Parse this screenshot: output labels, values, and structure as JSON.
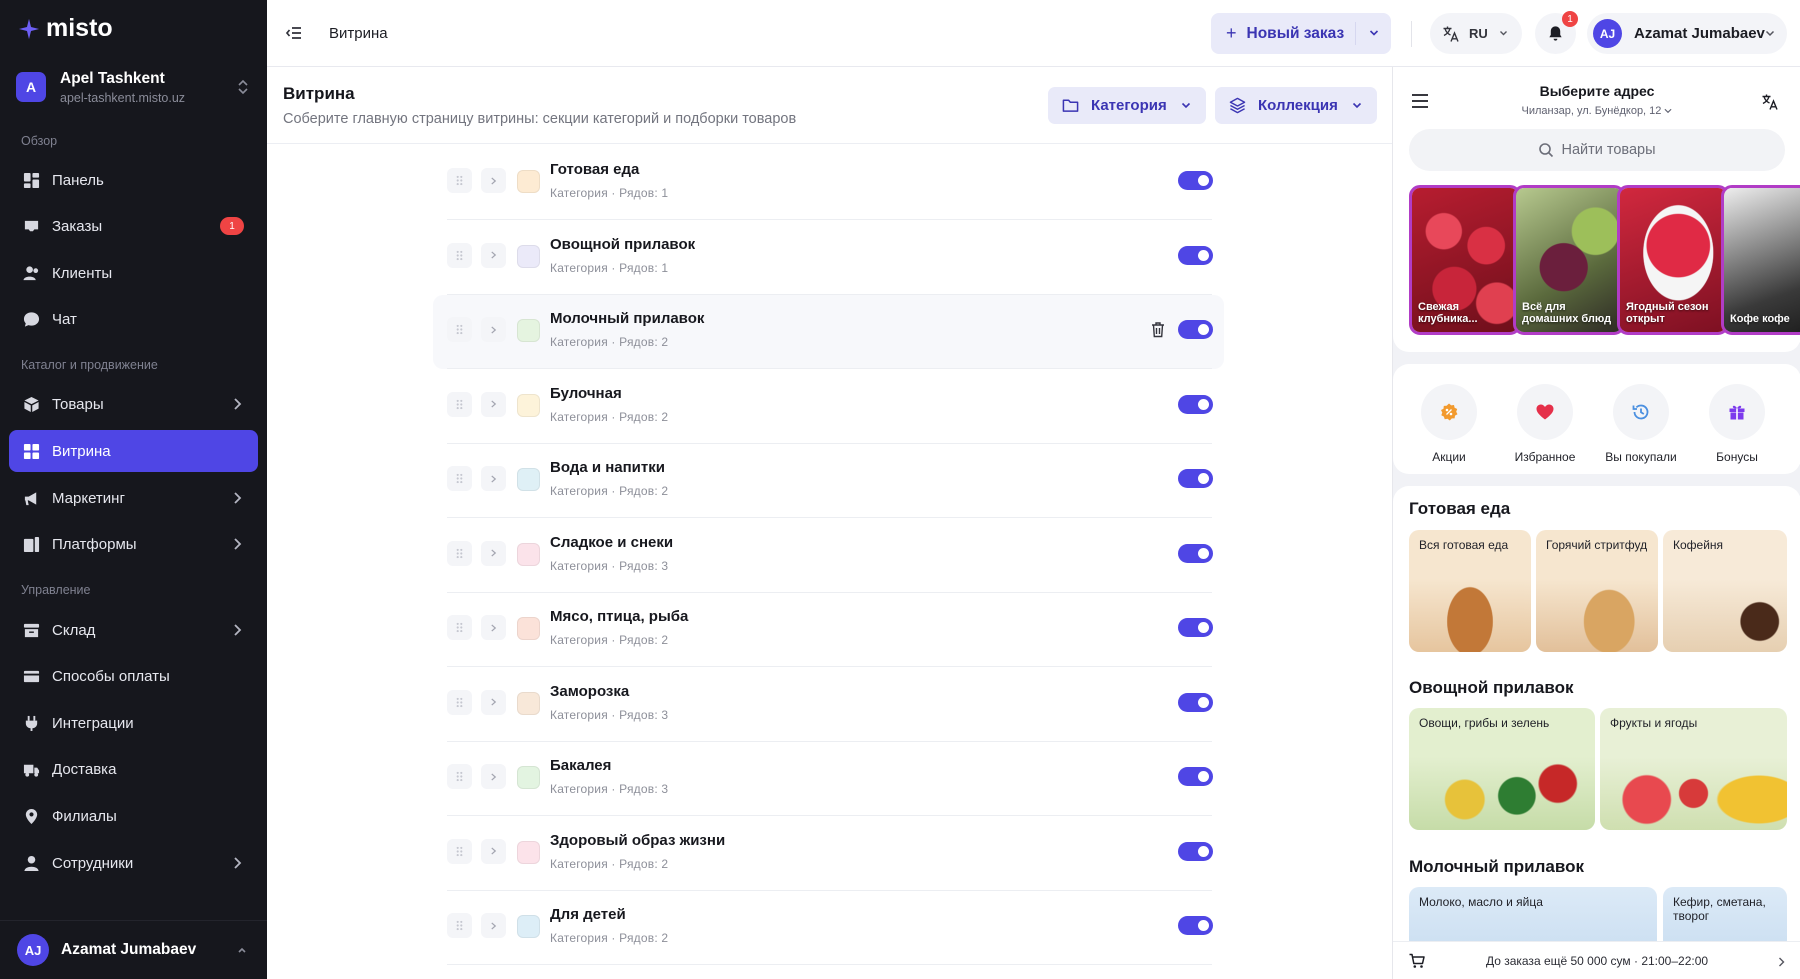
{
  "brand": {
    "name": "misto"
  },
  "org": {
    "initial": "A",
    "name": "Apel Tashkent",
    "url": "apel-tashkent.misto.uz"
  },
  "sidebar": {
    "sections": {
      "overview": "Обзор",
      "catalog": "Каталог и продвижение",
      "management": "Управление"
    },
    "items": [
      {
        "label": "Панель",
        "icon": "dashboard-icon"
      },
      {
        "label": "Заказы",
        "icon": "orders-icon",
        "badge": "1"
      },
      {
        "label": "Клиенты",
        "icon": "users-icon"
      },
      {
        "label": "Чат",
        "icon": "chat-icon"
      },
      {
        "label": "Товары",
        "icon": "box-icon"
      },
      {
        "label": "Витрина",
        "icon": "grid-icon",
        "active": true
      },
      {
        "label": "Маркетинг",
        "icon": "megaphone-icon"
      },
      {
        "label": "Платформы",
        "icon": "platforms-icon"
      },
      {
        "label": "Склад",
        "icon": "warehouse-icon"
      },
      {
        "label": "Способы оплаты",
        "icon": "card-icon"
      },
      {
        "label": "Интеграции",
        "icon": "plug-icon"
      },
      {
        "label": "Доставка",
        "icon": "truck-icon"
      },
      {
        "label": "Филиалы",
        "icon": "pin-icon"
      },
      {
        "label": "Сотрудники",
        "icon": "staff-icon"
      }
    ],
    "user": {
      "initials": "AJ",
      "name": "Azamat Jumabaev"
    }
  },
  "topbar": {
    "breadcrumb": "Витрина",
    "new_order": "Новый заказ",
    "lang": "RU",
    "notifications": "1",
    "user": {
      "initials": "AJ",
      "name": "Azamat Jumabaev"
    }
  },
  "page": {
    "title": "Витрина",
    "subtitle": "Соберите главную страницу витрины: секции категорий и подборки товаров",
    "btn_category": "Категория",
    "btn_collection": "Коллекция"
  },
  "sections": [
    {
      "name": "Готовая еда",
      "meta": "Категория · Рядов: 1",
      "color": "#fdebd3",
      "enabled": true
    },
    {
      "name": "Овощной прилавок",
      "meta": "Категория · Рядов: 1",
      "color": "#ebeaf9",
      "enabled": true
    },
    {
      "name": "Молочный прилавок",
      "meta": "Категория · Рядов: 2",
      "color": "#e5f4e0",
      "enabled": true,
      "hovered": true
    },
    {
      "name": "Булочная",
      "meta": "Категория · Рядов: 2",
      "color": "#fdf3da",
      "enabled": true
    },
    {
      "name": "Вода и напитки",
      "meta": "Категория · Рядов: 2",
      "color": "#dff0f6",
      "enabled": true
    },
    {
      "name": "Сладкое и снеки",
      "meta": "Категория · Рядов: 3",
      "color": "#fbe3ea",
      "enabled": true
    },
    {
      "name": "Мясо, птица, рыба",
      "meta": "Категория · Рядов: 2",
      "color": "#fbe2d9",
      "enabled": true
    },
    {
      "name": "Заморозка",
      "meta": "Категория · Рядов: 3",
      "color": "#f8e8d9",
      "enabled": true
    },
    {
      "name": "Бакалея",
      "meta": "Категория · Рядов: 3",
      "color": "#e3f4e1",
      "enabled": true
    },
    {
      "name": "Здоровый образ жизни",
      "meta": "Категория · Рядов: 2",
      "color": "#fce3ea",
      "enabled": true
    },
    {
      "name": "Для детей",
      "meta": "Категория · Рядов: 2",
      "color": "#ddeef7",
      "enabled": true
    }
  ],
  "preview": {
    "address_title": "Выберите адрес",
    "address_sub": "Чиланзар, ул. Бунёдкор, 12",
    "search_placeholder": "Найти товары",
    "stories": [
      {
        "caption": "Свежая клубника..."
      },
      {
        "caption": "Всё для домашних блюд"
      },
      {
        "caption": "Ягодный сезон открыт"
      },
      {
        "caption": "Кофе кофе"
      }
    ],
    "quick": [
      {
        "label": "Акции",
        "icon": "percent-icon"
      },
      {
        "label": "Избранное",
        "icon": "heart-icon"
      },
      {
        "label": "Вы покупали",
        "icon": "history-icon"
      },
      {
        "label": "Бонусы",
        "icon": "gift-icon"
      }
    ],
    "shop_sections": [
      {
        "title": "Готовая еда",
        "tiles": [
          "Вся готовая еда",
          "Горячий стритфуд",
          "Кофейня"
        ]
      },
      {
        "title": "Овощной прилавок",
        "tiles": [
          "Овощи, грибы и зелень",
          "Фрукты и ягоды"
        ]
      },
      {
        "title": "Молочный прилавок",
        "tiles": [
          "Молоко, масло и яйца",
          "Кефир, сметана, творог"
        ]
      }
    ],
    "cart_text": "До заказа ещё 50 000 сум · 21:00–22:00"
  },
  "colors": {
    "accent": "#4f46e5",
    "sidebar_bg": "#16171d",
    "badge": "#ef4444",
    "story_ring": "#b13cc6"
  }
}
